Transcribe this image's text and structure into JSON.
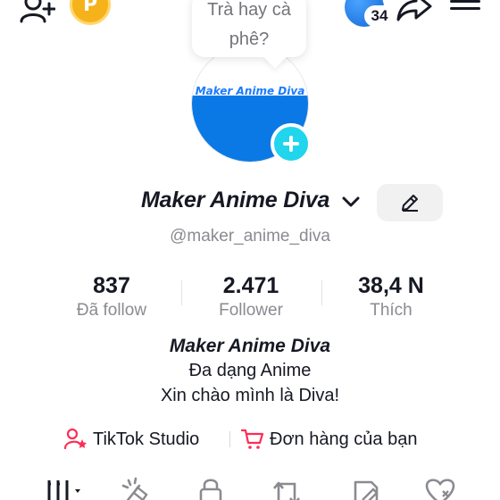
{
  "header": {
    "points_badge": "P",
    "notification_count": "34",
    "icons": [
      "add-friend-icon",
      "points-icon",
      "share-icon",
      "menu-icon"
    ]
  },
  "tooltip": {
    "line1": "Trà hay cà",
    "line2": "phê?"
  },
  "avatar": {
    "logo_text": "Maker Anime Diva"
  },
  "profile": {
    "display_name": "Maker Anime Diva",
    "username": "@maker_anime_diva"
  },
  "stats": [
    {
      "value": "837",
      "label": "Đã follow"
    },
    {
      "value": "2.471",
      "label": "Follower"
    },
    {
      "value": "38,4 N",
      "label": "Thích"
    }
  ],
  "bio": {
    "title": "Maker Anime Diva",
    "lines": [
      "Đa dạng Anime",
      "Xin chào mình là Diva!"
    ]
  },
  "links": {
    "studio": "TikTok Studio",
    "orders": "Đơn hàng của bạn"
  },
  "colors": {
    "accent_cyan": "#20d5ec",
    "accent_pink": "#fe2c55",
    "text_primary": "#161823",
    "text_secondary": "#8a8b91"
  },
  "tabs": [
    "videos-grid-tab",
    "reposts-tab",
    "private-tab",
    "repost-arrows-tab",
    "favorites-tab",
    "liked-tab"
  ]
}
